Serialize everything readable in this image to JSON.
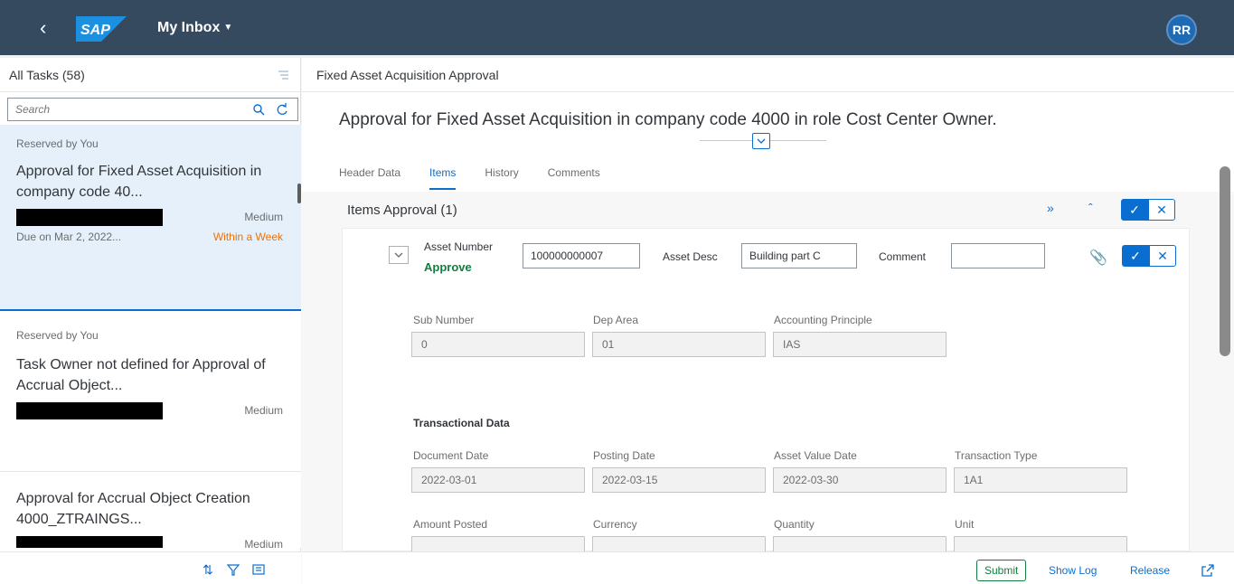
{
  "shell": {
    "title": "My Inbox",
    "logo_text": "SAP",
    "avatar_initials": "RR",
    "colors": {
      "shell_bg": "#354a5f",
      "accent": "#0a6ed1",
      "positive": "#107e3e",
      "warning": "#e9730c"
    }
  },
  "master": {
    "heading": "All Tasks (58)",
    "search_placeholder": "Search",
    "items": [
      {
        "reserved": "Reserved by You",
        "title": "Approval for Fixed Asset Acquisition in company code 40...",
        "priority": "Medium",
        "due": "Due on Mar 2, 2022...",
        "due_status": "Within a Week"
      },
      {
        "reserved": "Reserved by You",
        "title": "Task Owner not defined for Approval of Accrual Object...",
        "priority": "Medium"
      },
      {
        "title": "Approval for Accrual Object Creation 4000_ZTRAINGS...",
        "priority": "Medium"
      }
    ]
  },
  "detail": {
    "header": "Fixed Asset Acquisition Approval",
    "object_title": "Approval for Fixed Asset Acquisition in company code 4000 in role Cost Center Owner.",
    "tabs": [
      "Header Data",
      "Items",
      "History",
      "Comments"
    ],
    "active_tab": "Items",
    "section_title": "Items Approval (1)",
    "item": {
      "asset_number_label": "Asset Number",
      "status": "Approve",
      "asset_number_value": "100000000007",
      "asset_desc_label": "Asset Desc",
      "asset_desc_value": "Building part C",
      "comment_label": "Comment",
      "comment_value": "",
      "sub_number_label": "Sub Number",
      "sub_number_value": "0",
      "dep_area_label": "Dep Area",
      "dep_area_value": "01",
      "accounting_principle_label": "Accounting Principle",
      "accounting_principle_value": "IAS",
      "transactional_heading": "Transactional Data",
      "document_date_label": "Document Date",
      "document_date_value": "2022-03-01",
      "posting_date_label": "Posting Date",
      "posting_date_value": "2022-03-15",
      "asset_value_date_label": "Asset Value Date",
      "asset_value_date_value": "2022-03-30",
      "transaction_type_label": "Transaction Type",
      "transaction_type_value": "1A1",
      "amount_posted_label": "Amount Posted",
      "currency_label": "Currency",
      "quantity_label": "Quantity",
      "unit_label": "Unit"
    }
  },
  "footer": {
    "submit": "Submit",
    "show_log": "Show Log",
    "release": "Release"
  }
}
